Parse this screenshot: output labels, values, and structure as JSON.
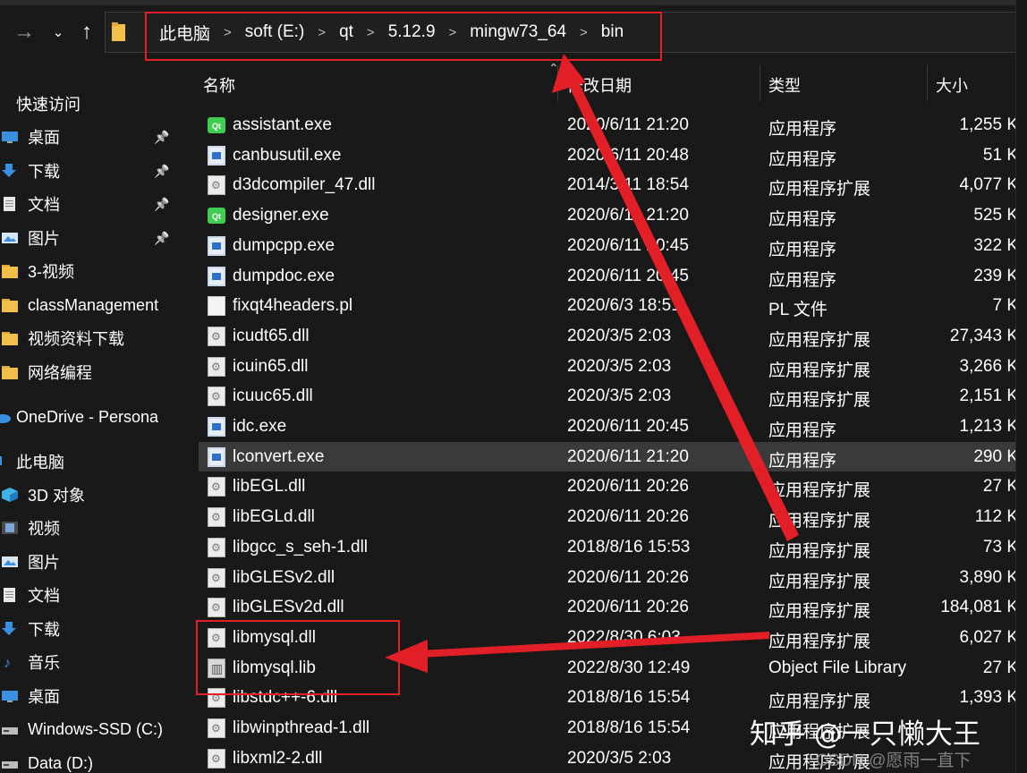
{
  "address_bar": {
    "breadcrumbs": [
      "此电脑",
      "soft (E:)",
      "qt",
      "5.12.9",
      "mingw73_64",
      "bin"
    ],
    "separator": ">"
  },
  "nav": {
    "back_icon": "arrow-right-icon",
    "recent_icon": "chevron-down-icon",
    "up_icon": "arrow-up-icon"
  },
  "sidebar": {
    "items": [
      {
        "label": "快速访问",
        "icon": "star-icon",
        "pinned": false
      },
      {
        "label": "桌面",
        "icon": "desktop-icon",
        "pinned": true
      },
      {
        "label": "下载",
        "icon": "download-icon",
        "pinned": true
      },
      {
        "label": "文档",
        "icon": "document-icon",
        "pinned": true
      },
      {
        "label": "图片",
        "icon": "pictures-icon",
        "pinned": true
      },
      {
        "label": "3-视频",
        "icon": "folder-icon",
        "pinned": false
      },
      {
        "label": "classManagement",
        "icon": "folder-icon",
        "pinned": false
      },
      {
        "label": "视频资料下载",
        "icon": "folder-icon",
        "pinned": false
      },
      {
        "label": "网络编程",
        "icon": "folder-icon",
        "pinned": false
      },
      {
        "label": "OneDrive - Persona",
        "icon": "cloud-icon",
        "pinned": false
      },
      {
        "label": "此电脑",
        "icon": "computer-icon",
        "pinned": false
      },
      {
        "label": "3D 对象",
        "icon": "cube-icon",
        "pinned": false
      },
      {
        "label": "视频",
        "icon": "video-icon",
        "pinned": false
      },
      {
        "label": "图片",
        "icon": "pictures-icon",
        "pinned": false
      },
      {
        "label": "文档",
        "icon": "document-icon",
        "pinned": false
      },
      {
        "label": "下载",
        "icon": "download-icon",
        "pinned": false
      },
      {
        "label": "音乐",
        "icon": "music-icon",
        "pinned": false
      },
      {
        "label": "桌面",
        "icon": "desktop-icon",
        "pinned": false
      },
      {
        "label": "Windows-SSD (C:)",
        "icon": "drive-icon",
        "pinned": false
      },
      {
        "label": "Data (D:)",
        "icon": "drive-icon",
        "pinned": false
      }
    ]
  },
  "columns": {
    "name": "名称",
    "date": "修改日期",
    "type": "类型",
    "size": "大小"
  },
  "files": [
    {
      "name": "assistant.exe",
      "date": "2020/6/11 21:20",
      "type": "应用程序",
      "size": "1,255 K",
      "icon": "qt-icon"
    },
    {
      "name": "canbusutil.exe",
      "date": "2020/6/11 20:48",
      "type": "应用程序",
      "size": "51 K",
      "icon": "exe-icon"
    },
    {
      "name": "d3dcompiler_47.dll",
      "date": "2014/3/11 18:54",
      "type": "应用程序扩展",
      "size": "4,077 K",
      "icon": "dll-icon"
    },
    {
      "name": "designer.exe",
      "date": "2020/6/11 21:20",
      "type": "应用程序",
      "size": "525 K",
      "icon": "qt-icon"
    },
    {
      "name": "dumpcpp.exe",
      "date": "2020/6/11 20:45",
      "type": "应用程序",
      "size": "322 K",
      "icon": "exe-icon"
    },
    {
      "name": "dumpdoc.exe",
      "date": "2020/6/11 20:45",
      "type": "应用程序",
      "size": "239 K",
      "icon": "exe-icon"
    },
    {
      "name": "fixqt4headers.pl",
      "date": "2020/6/3 18:51",
      "type": "PL 文件",
      "size": "7 K",
      "icon": "file-icon"
    },
    {
      "name": "icudt65.dll",
      "date": "2020/3/5 2:03",
      "type": "应用程序扩展",
      "size": "27,343 K",
      "icon": "dll-icon"
    },
    {
      "name": "icuin65.dll",
      "date": "2020/3/5 2:03",
      "type": "应用程序扩展",
      "size": "3,266 K",
      "icon": "dll-icon"
    },
    {
      "name": "icuuc65.dll",
      "date": "2020/3/5 2:03",
      "type": "应用程序扩展",
      "size": "2,151 K",
      "icon": "dll-icon"
    },
    {
      "name": "idc.exe",
      "date": "2020/6/11 20:45",
      "type": "应用程序",
      "size": "1,213 K",
      "icon": "exe-icon"
    },
    {
      "name": "lconvert.exe",
      "date": "2020/6/11 21:20",
      "type": "应用程序",
      "size": "290 K",
      "icon": "exe-icon",
      "selected": true
    },
    {
      "name": "libEGL.dll",
      "date": "2020/6/11 20:26",
      "type": "应用程序扩展",
      "size": "27 K",
      "icon": "dll-icon"
    },
    {
      "name": "libEGLd.dll",
      "date": "2020/6/11 20:26",
      "type": "应用程序扩展",
      "size": "112 K",
      "icon": "dll-icon"
    },
    {
      "name": "libgcc_s_seh-1.dll",
      "date": "2018/8/16 15:53",
      "type": "应用程序扩展",
      "size": "73 K",
      "icon": "dll-icon"
    },
    {
      "name": "libGLESv2.dll",
      "date": "2020/6/11 20:26",
      "type": "应用程序扩展",
      "size": "3,890 K",
      "icon": "dll-icon"
    },
    {
      "name": "libGLESv2d.dll",
      "date": "2020/6/11 20:26",
      "type": "应用程序扩展",
      "size": "184,081 K",
      "icon": "dll-icon"
    },
    {
      "name": "libmysql.dll",
      "date": "2022/8/30 6:03",
      "type": "应用程序扩展",
      "size": "6,027 K",
      "icon": "dll-icon"
    },
    {
      "name": "libmysql.lib",
      "date": "2022/8/30 12:49",
      "type": "Object File Library",
      "size": "27 K",
      "icon": "lib-icon"
    },
    {
      "name": "libstdc++-6.dll",
      "date": "2018/8/16 15:54",
      "type": "应用程序扩展",
      "size": "1,393 K",
      "icon": "dll-icon"
    },
    {
      "name": "libwinpthread-1.dll",
      "date": "2018/8/16 15:54",
      "type": "应用程序扩展",
      "size": "",
      "icon": "dll-icon"
    },
    {
      "name": "libxml2-2.dll",
      "date": "2020/3/5 2:03",
      "type": "应用程序扩展",
      "size": "",
      "icon": "dll-icon"
    }
  ],
  "annotations": {
    "color": "#e21f26"
  },
  "watermark": {
    "main": "知乎 @一只懒大王",
    "secondary": "CSDN @愿雨一直下"
  },
  "colors": {
    "background": "#191919",
    "selected_row": "#3a3a3a",
    "text": "#ffffff"
  }
}
